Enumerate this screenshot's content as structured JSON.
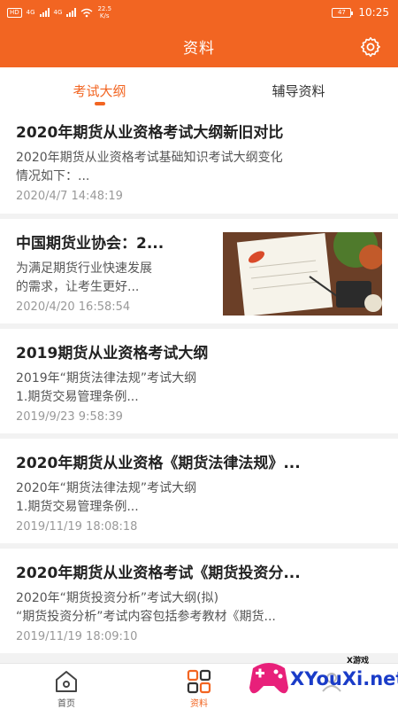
{
  "status_bar": {
    "network_badge": "HD",
    "signal_1": "4G",
    "signal_2": "4G",
    "speed_value": "22.5",
    "speed_unit": "K/s",
    "battery": "47",
    "time": "10:25"
  },
  "header": {
    "title": "资料",
    "settings_icon": "gear-icon"
  },
  "tabs": [
    {
      "label": "考试大纲",
      "active": true
    },
    {
      "label": "辅导资料",
      "active": false
    }
  ],
  "articles": [
    {
      "title": "2020年期货从业资格考试大纲新旧对比",
      "summary_lines": [
        "2020年期货从业资格考试基础知识考试大纲变化",
        "情况如下：..."
      ],
      "date": "2020/4/7 14:48:19",
      "has_image": false
    },
    {
      "title": "中国期货业协会：2...",
      "summary_lines": [
        "为满足期货行业快速发展",
        "的需求，让考生更好..."
      ],
      "date": "2020/4/20 16:58:54",
      "has_image": true
    },
    {
      "title": "2019期货从业资格考试大纲",
      "summary_lines": [
        "2019年“期货法律法规”考试大纲",
        "1.期货交易管理条例..."
      ],
      "date": "2019/9/23 9:58:39",
      "has_image": false
    },
    {
      "title": "2020年期货从业资格《期货法律法规》...",
      "summary_lines": [
        "2020年“期货法律法规”考试大纲",
        "1.期货交易管理条例..."
      ],
      "date": "2019/11/19 18:08:18",
      "has_image": false
    },
    {
      "title": "2020年期货从业资格考试《期货投资分...",
      "summary_lines": [
        "2020年“期货投资分析”考试大纲(拟)",
        "“期货投资分析”考试内容包括参考教材《期货..."
      ],
      "date": "2019/11/19 18:09:10",
      "has_image": false
    }
  ],
  "bottom_nav": [
    {
      "label": "首页",
      "icon": "home-icon",
      "active": false
    },
    {
      "label": "资料",
      "icon": "grid-icon",
      "active": true
    },
    {
      "label": "",
      "icon": "profile-icon",
      "active": false
    }
  ],
  "watermark": {
    "brand": "XYouXi.net",
    "tag": "X游戏"
  },
  "colors": {
    "accent": "#f26522",
    "text_primary": "#222222",
    "text_secondary": "#555555",
    "text_muted": "#999999",
    "background": "#f2f2f2"
  }
}
